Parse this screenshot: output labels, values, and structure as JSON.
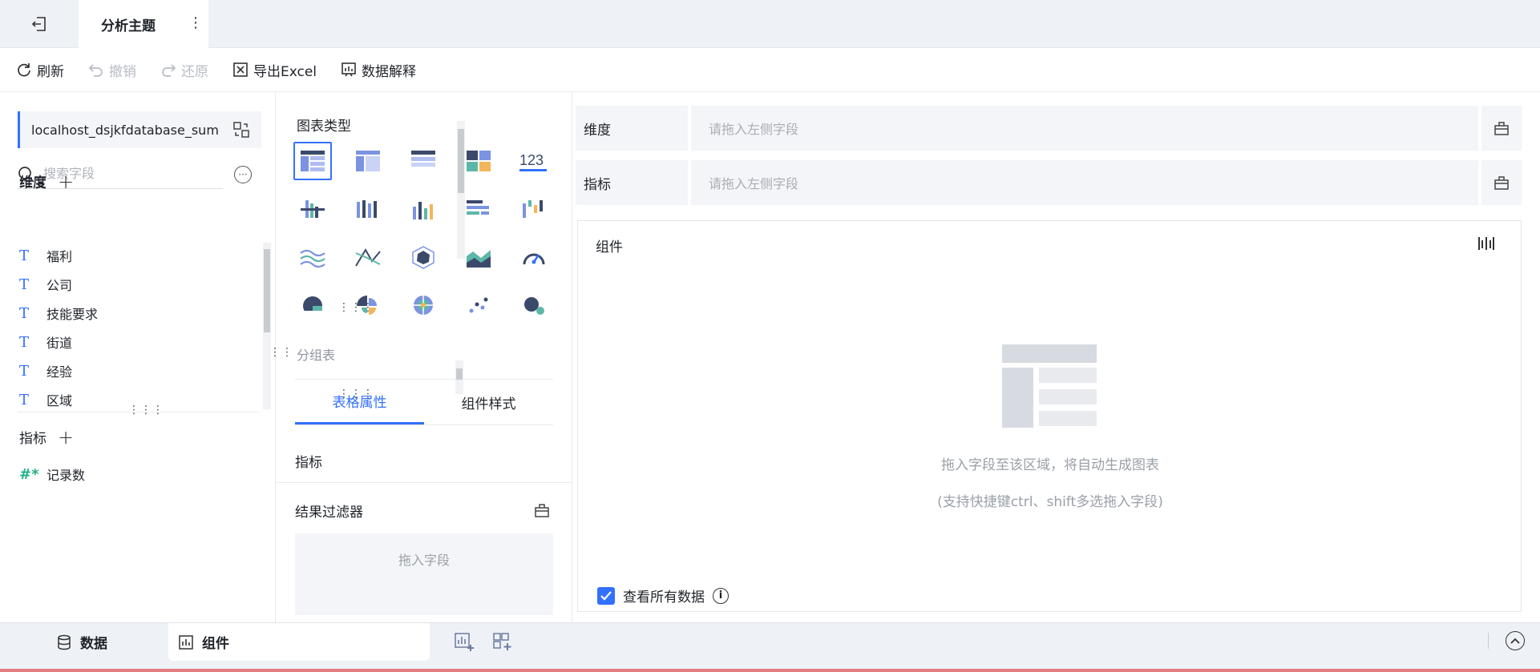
{
  "header": {
    "title": "分析主题",
    "more_label": "⋮"
  },
  "toolbar": {
    "refresh": "刷新",
    "undo": "撤销",
    "redo": "还原",
    "export_excel": "导出Excel",
    "data_explain": "数据解释"
  },
  "datasource": {
    "name": "localhost_dsjkfdatabase_sum"
  },
  "search": {
    "placeholder": "搜索字段"
  },
  "dimensions": {
    "label": "维度",
    "items": [
      {
        "type_icon": "T",
        "label": "福利"
      },
      {
        "type_icon": "T",
        "label": "公司"
      },
      {
        "type_icon": "T",
        "label": "技能要求"
      },
      {
        "type_icon": "T",
        "label": "街道"
      },
      {
        "type_icon": "T",
        "label": "经验"
      },
      {
        "type_icon": "T",
        "label": "区域"
      }
    ]
  },
  "measures": {
    "label": "指标",
    "items": [
      {
        "type_icon": "#*",
        "label": "记录数"
      }
    ]
  },
  "chart_types": {
    "title": "图表类型",
    "selected_name": "分组表"
  },
  "config_tabs": {
    "table_props": "表格属性",
    "component_style": "组件样式"
  },
  "props": {
    "metric_label": "指标"
  },
  "filter": {
    "title": "结果过滤器",
    "drop_text": "拖入字段"
  },
  "shelves": {
    "dimension_label": "维度",
    "dimension_placeholder": "请拖入左侧字段",
    "metric_label": "指标",
    "metric_placeholder": "请拖入左侧字段"
  },
  "canvas": {
    "title": "组件",
    "hint_main": "拖入字段至该区域，将自动生成图表",
    "hint_sub": "(支持快捷键ctrl、shift多选拖入字段)",
    "view_all_data": "查看所有数据",
    "view_all_checked": true
  },
  "bottom_tabs": {
    "data": "数据",
    "component": "组件"
  },
  "colors": {
    "accent": "#3370ff",
    "teal": "#21b08a"
  }
}
